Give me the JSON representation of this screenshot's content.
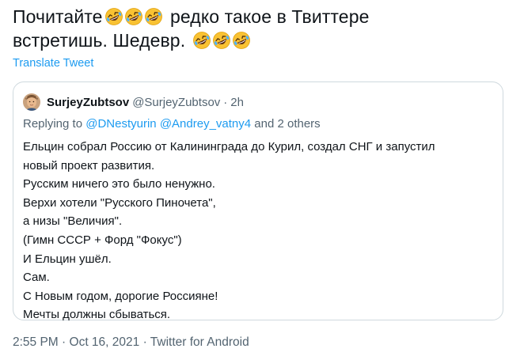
{
  "tweet": {
    "line1_text": "Почитайте",
    "line1_text_after": " редко такое в Твиттере",
    "line2_text": "встретишь. Шедевр. ",
    "emoji": "rolling-on-floor-laughing-icon"
  },
  "translate_label": "Translate Tweet",
  "quote": {
    "author_name": "SurjeyZubtsov",
    "author_handle": "@SurjeyZubtsov",
    "separator": "·",
    "time": "2h",
    "replying_prefix": "Replying to ",
    "mention1": "@DNestyurin",
    "mention2": "@Andrey_vatny4",
    "replying_suffix": " and 2 others",
    "lines": [
      "Ельцин собрал Россию от Калининграда до Курил, создал СНГ и запустил",
      "новый проект развития.",
      "Русским ничего это было ненужно.",
      "Верхи хотели \"Русского Пиночета\",",
      "а низы \"Величия\".",
      "(Гимн СССР + Форд \"Фокус\")",
      "И Ельцин ушёл.",
      "Сам.",
      "С Новым годом, дорогие Россияне!",
      "Мечты должны сбываться."
    ]
  },
  "meta": {
    "time": "2:55 PM",
    "separator": " · ",
    "date": "Oct 16, 2021",
    "source": "Twitter for Android"
  },
  "colors": {
    "link": "#1d9bf0",
    "secondary": "#536471",
    "border": "#cfd9de",
    "text": "#0f1419"
  }
}
